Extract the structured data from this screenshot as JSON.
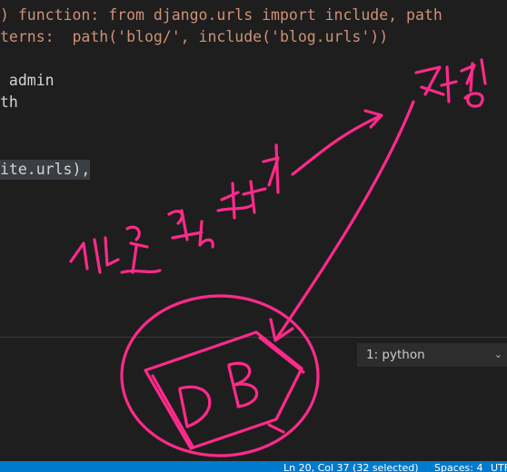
{
  "editor": {
    "lines": [
      ") function: from django.urls import include, path",
      "terns:  path('blog/', include('blog.urls'))",
      "",
      " admin",
      "th",
      "",
      "",
      "ite.urls),"
    ]
  },
  "terminal": {
    "dropdown_value": "1: python"
  },
  "statusbar": {
    "position": "Ln 20, Col 37 (32 selected)",
    "spaces": "Spaces: 4",
    "encoding": "UTF"
  },
  "annotation": {
    "label_left": "데이터 만들기",
    "label_right": "저장",
    "db_label": "DB",
    "color": "#ff2a8a"
  },
  "colors": {
    "editor_bg": "#1e1e1e",
    "comment": "#ce9178",
    "selection": "#3a3d41",
    "status_bar": "#007acc"
  }
}
